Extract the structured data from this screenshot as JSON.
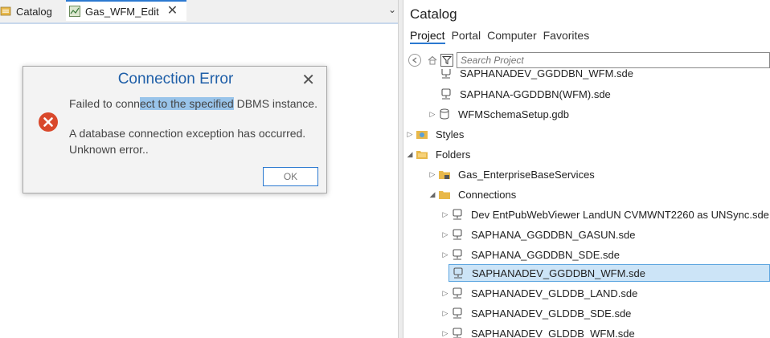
{
  "left_tabs": {
    "catalog": "Catalog",
    "edit": "Gas_WFM_Edit",
    "close": "✕",
    "dropdown": "⌄"
  },
  "dialog": {
    "title": "Connection Error",
    "close": "✕",
    "line1_pre": "Failed to conn",
    "line1_hl": "ect to the specified",
    "line1_post": " DBMS instance.",
    "line2": "A database connection exception has occurred.",
    "line3": "Unknown error..",
    "ok": "OK"
  },
  "catalog": {
    "title": "Catalog",
    "tabs": [
      "Project",
      "Portal",
      "Computer",
      "Favorites"
    ],
    "search_placeholder": "Search Project",
    "tree": [
      {
        "label": "SAPHANADEV_GGDDBN_WFM.sde",
        "icon": "database-connection-icon",
        "expander": ""
      },
      {
        "label": "SAPHANA-GGDDBN(WFM).sde",
        "icon": "database-connection-icon",
        "expander": ""
      },
      {
        "label": "WFMSchemaSetup.gdb",
        "icon": "geodatabase-icon",
        "expander": "▷"
      },
      {
        "label": "Styles",
        "icon": "styles-folder-icon",
        "expander": "▷"
      },
      {
        "label": "Folders",
        "icon": "folders-icon",
        "expander": "◢"
      },
      {
        "label": "Gas_EnterpriseBaseServices",
        "icon": "locked-folder-icon",
        "expander": "▷"
      },
      {
        "label": "Connections",
        "icon": "folder-icon",
        "expander": "◢"
      },
      {
        "label": "Dev EntPubWebViewer LandUN CVMWNT2260 as UNSync.sde",
        "icon": "database-connection-icon",
        "expander": "▷"
      },
      {
        "label": "SAPHANA_GGDDBN_GASUN.sde",
        "icon": "database-connection-icon",
        "expander": "▷"
      },
      {
        "label": "SAPHANA_GGDDBN_SDE.sde",
        "icon": "database-connection-icon",
        "expander": "▷"
      },
      {
        "label": "SAPHANADEV_GGDDBN_WFM.sde",
        "icon": "database-connection-icon",
        "expander": ""
      },
      {
        "label": "SAPHANADEV_GLDDB_LAND.sde",
        "icon": "database-connection-icon",
        "expander": "▷"
      },
      {
        "label": "SAPHANADEV_GLDDB_SDE.sde",
        "icon": "database-connection-icon",
        "expander": "▷"
      },
      {
        "label": "SAPHANADEV_GLDDB_WFM.sde",
        "icon": "database-connection-icon",
        "expander": "▷"
      }
    ]
  },
  "colors": {
    "accent": "#2b79d0",
    "dialog_title": "#1f5fa8",
    "error_red": "#d9482b",
    "selection": "#cce4f7",
    "highlight": "#99c4ea",
    "folder_yellow": "#e8b84a"
  }
}
